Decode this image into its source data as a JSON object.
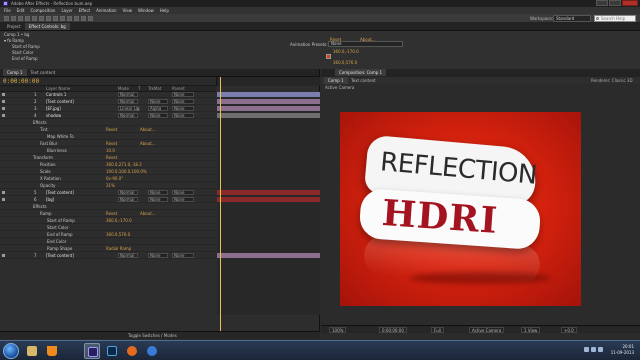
{
  "window": {
    "title": "Adobe After Effects - Reflection bum.aep"
  },
  "menubar": [
    "File",
    "Edit",
    "Composition",
    "Layer",
    "Effect",
    "Animation",
    "View",
    "Window",
    "Help"
  ],
  "toolbar": {
    "workspace_label": "Workspace:",
    "workspace_value": "Standard",
    "search_placeholder": "Search Help"
  },
  "effects_panel": {
    "tabs": [
      "Project",
      "Effect Controls: bg"
    ],
    "comp_label": "Comp 1 • bg",
    "rows": [
      {
        "name": "Ramp",
        "action": "Reset",
        "extra": "About..."
      },
      {
        "name": "Start of Ramp",
        "value": "360.0,-170.0"
      },
      {
        "name": "Start Color",
        "value": ""
      },
      {
        "name": "End of Ramp",
        "value": "360.0,576.0"
      }
    ],
    "animation_presets_label": "Animation Presets:",
    "animation_presets_value": "None"
  },
  "timeline": {
    "tabs": [
      "Comp 1",
      "Text content"
    ],
    "timecode": "0:00:00:00",
    "columns": [
      "Layer Name",
      "Mode",
      "T",
      "TrkMat",
      "Parent"
    ],
    "layers": [
      {
        "num": "1",
        "name": "Controls 1",
        "mode": "Normal",
        "trk": "",
        "parent": "None",
        "color": "#7a7fb0"
      },
      {
        "num": "2",
        "name": "[Text content]",
        "mode": "Normal",
        "trk": "None",
        "parent": "None",
        "color": "#8c6f8f"
      },
      {
        "num": "3",
        "name": "[EF.jpg]",
        "mode": "Linear Lig",
        "trk": "Alpha",
        "parent": "None",
        "color": "#8c6f8f"
      },
      {
        "num": "4",
        "name": "shadow",
        "mode": "Normal",
        "trk": "None",
        "parent": "None",
        "color": "#6f6f6f"
      }
    ],
    "props": [
      {
        "indent": 1,
        "name": "Effects",
        "value": ""
      },
      {
        "indent": 2,
        "name": "Tint",
        "value": "Reset",
        "extra": "About..."
      },
      {
        "indent": 3,
        "name": "Map White To",
        "value": ""
      },
      {
        "indent": 2,
        "name": "Fast Blur",
        "value": "Reset",
        "extra": "About..."
      },
      {
        "indent": 3,
        "name": "Blurriness",
        "value": "10.0"
      },
      {
        "indent": 1,
        "name": "Transform",
        "value": "Reset"
      },
      {
        "indent": 2,
        "name": "Position",
        "value": "360.0,271.0,-18.2"
      },
      {
        "indent": 2,
        "name": "Scale",
        "value": "100.0,100.0,100.0%"
      },
      {
        "indent": 2,
        "name": "X Rotation",
        "value": "0x-90.0°"
      },
      {
        "indent": 2,
        "name": "Opacity",
        "value": "31%"
      }
    ],
    "layers2": [
      {
        "num": "5",
        "name": "[Text content]",
        "mode": "Normal",
        "trk": "None",
        "parent": "None",
        "color": "#8c2a2a"
      },
      {
        "num": "6",
        "name": "[bg]",
        "mode": "Normal",
        "trk": "None",
        "parent": "None",
        "color": "#8c2a2a"
      }
    ],
    "props2": [
      {
        "indent": 1,
        "name": "Effects",
        "value": ""
      },
      {
        "indent": 2,
        "name": "Ramp",
        "value": "Reset",
        "extra": "About..."
      },
      {
        "indent": 3,
        "name": "Start of Ramp",
        "value": "360.0,-170.0"
      },
      {
        "indent": 3,
        "name": "Start Color",
        "value": ""
      },
      {
        "indent": 3,
        "name": "End of Ramp",
        "value": "360.0,576.0"
      },
      {
        "indent": 3,
        "name": "End Color",
        "value": ""
      },
      {
        "indent": 3,
        "name": "Ramp Shape",
        "value": "Radial Ramp"
      }
    ],
    "layers3": [
      {
        "num": "7",
        "name": "[Text content]",
        "mode": "Normal",
        "trk": "None",
        "parent": "None",
        "color": "#8c6f8f"
      }
    ],
    "footer_label": "Toggle Switches / Modes"
  },
  "composition": {
    "tab": "Composition: Comp 1",
    "subtabs": [
      "Comp 1",
      "Text content"
    ],
    "renderer_label": "Renderer:",
    "renderer_value": "Classic 3D",
    "camera_label": "Active Camera",
    "artwork": {
      "line1": "REFLECTION",
      "line2": "HDRI"
    },
    "footer": {
      "zoom": "100%",
      "timecode": "0:00:00:00",
      "resolution": "Full",
      "camera": "Active Camera",
      "views": "1 View",
      "offset": "+0.0"
    }
  },
  "taskbar": {
    "time": "20:01",
    "date": "11-09-2013",
    "apps": [
      "explorer",
      "vlc",
      "after-effects",
      "photoshop",
      "firefox",
      "media-player"
    ]
  },
  "colors": {
    "accent": "#e0b24a",
    "link": "#6fa7e0",
    "comp_bg": "#d8230e",
    "hdri": "#a31420"
  }
}
